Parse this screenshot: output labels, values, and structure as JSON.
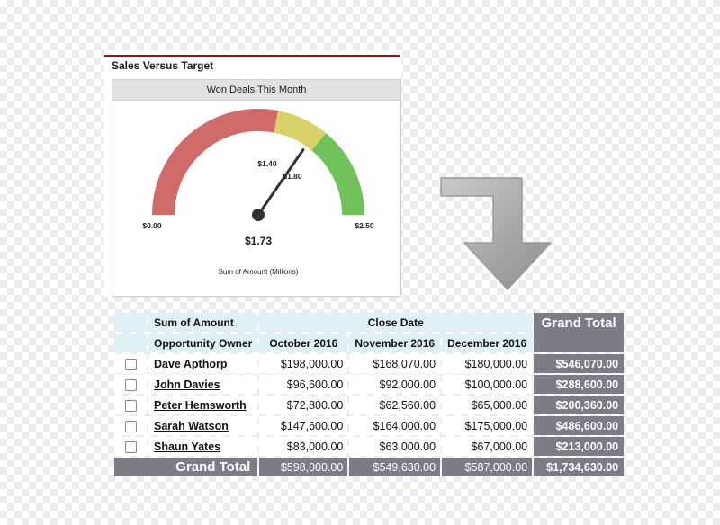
{
  "panel": {
    "title": "Sales Versus Target",
    "card_title": "Won Deals This Month"
  },
  "gauge": {
    "min_label": "$0.00",
    "max_label": "$2.50",
    "threshold_1_label": "$1.40",
    "threshold_2_label": "$1.80",
    "value_label": "$1.73",
    "caption": "Sum of Amount (Millions)",
    "min": 0,
    "max": 2.5,
    "threshold_1": 1.4,
    "threshold_2": 1.8,
    "value": 1.73,
    "colors": {
      "red": "#cf6b6b",
      "yellow": "#d9d26a",
      "green": "#72c25c",
      "needle": "#333333"
    }
  },
  "arrow": {
    "icon": "turn-down-arrow-icon",
    "color": "#a9a9a9"
  },
  "table": {
    "measure_label": "Sum of Amount",
    "column_group_label": "Close Date",
    "row_field_label": "Opportunity Owner",
    "grand_total_label": "Grand Total",
    "months": [
      "October 2016",
      "November 2016",
      "December 2016"
    ],
    "rows": [
      {
        "owner": "Dave Apthorp",
        "values": [
          "$198,000.00",
          "$168,070.00",
          "$180,000.00"
        ],
        "total": "$546,070.00"
      },
      {
        "owner": "John Davies",
        "values": [
          "$96,600.00",
          "$92,000.00",
          "$100,000.00"
        ],
        "total": "$288,600.00"
      },
      {
        "owner": "Peter Hemsworth",
        "values": [
          "$72,800.00",
          "$62,560.00",
          "$65,000.00"
        ],
        "total": "$200,360.00"
      },
      {
        "owner": "Sarah Watson",
        "values": [
          "$147,600.00",
          "$164,000.00",
          "$175,000.00"
        ],
        "total": "$486,600.00"
      },
      {
        "owner": "Shaun Yates",
        "values": [
          "$83,000.00",
          "$63,000.00",
          "$67,000.00"
        ],
        "total": "$213,000.00"
      }
    ],
    "footer": {
      "label": "Grand Total",
      "values": [
        "$598,000.00",
        "$549,630.00",
        "$587,000.00"
      ],
      "total": "$1,734,630.00"
    },
    "colors": {
      "header_bg": "#dff0f6",
      "total_bg": "#7d7b86"
    }
  }
}
